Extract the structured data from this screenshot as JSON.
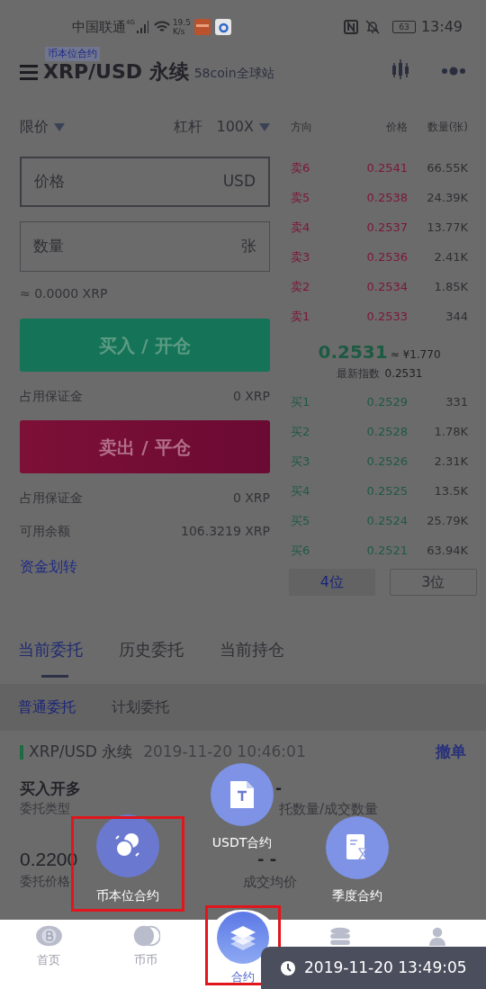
{
  "status_bar": {
    "carrier": "中国联通",
    "network": "4G",
    "speed": "19.5",
    "speed_unit": "K/s",
    "battery": "63",
    "time": "13:49"
  },
  "header": {
    "badge": "币本位合约",
    "title": "XRP/USD 永续",
    "subtitle": "58coin全球站"
  },
  "order_form": {
    "order_type": "限价",
    "leverage_label": "杠杆",
    "leverage": "100X",
    "price_field": {
      "placeholder": "价格",
      "unit": "USD"
    },
    "amount_field": {
      "placeholder": "数量",
      "unit": "张"
    },
    "estimate": "≈ 0.0000 XRP",
    "buy_button": "买入 / 开仓",
    "buy_margin": {
      "label": "占用保证金",
      "value": "0 XRP"
    },
    "sell_button": "卖出 / 平仓",
    "sell_margin": {
      "label": "占用保证金",
      "value": "0 XRP"
    },
    "available": {
      "label": "可用余额",
      "value": "106.3219 XRP"
    },
    "transfer_link": "资金划转"
  },
  "order_book": {
    "columns": [
      "方向",
      "价格",
      "数量(张)"
    ],
    "asks": [
      {
        "side": "卖6",
        "price": "0.2541",
        "amount": "66.55K"
      },
      {
        "side": "卖5",
        "price": "0.2538",
        "amount": "24.39K"
      },
      {
        "side": "卖4",
        "price": "0.2537",
        "amount": "13.77K"
      },
      {
        "side": "卖3",
        "price": "0.2536",
        "amount": "2.41K"
      },
      {
        "side": "卖2",
        "price": "0.2534",
        "amount": "1.85K"
      },
      {
        "side": "卖1",
        "price": "0.2533",
        "amount": "344"
      }
    ],
    "last_price": "0.2531",
    "cny": "≈ ¥1.770",
    "index_label": "最新指数",
    "index": "0.2531",
    "bids": [
      {
        "side": "买1",
        "price": "0.2529",
        "amount": "331"
      },
      {
        "side": "买2",
        "price": "0.2528",
        "amount": "1.78K"
      },
      {
        "side": "买3",
        "price": "0.2526",
        "amount": "2.31K"
      },
      {
        "side": "买4",
        "price": "0.2525",
        "amount": "13.5K"
      },
      {
        "side": "买5",
        "price": "0.2524",
        "amount": "25.79K"
      },
      {
        "side": "买6",
        "price": "0.2521",
        "amount": "63.94K"
      }
    ],
    "precision_buttons": [
      {
        "label": "4位",
        "selected": true
      },
      {
        "label": "3位",
        "selected": false
      }
    ]
  },
  "tabs": [
    {
      "label": "当前委托",
      "selected": true
    },
    {
      "label": "历史委托",
      "selected": false
    },
    {
      "label": "当前持仓",
      "selected": false
    }
  ],
  "sub_tabs": [
    {
      "label": "普通委托",
      "selected": true
    },
    {
      "label": "计划委托",
      "selected": false
    }
  ],
  "order": {
    "pair": "XRP/USD 永续",
    "time": "2019-11-20 10:46:01",
    "cancel": "撤单",
    "side": "买入开多",
    "side_label": "委托类型",
    "amount": "-",
    "amount_label": "托数量/成交数量",
    "price": "0.2200",
    "price_label": "委托价格",
    "avg": "- -",
    "avg_label": "成交均价"
  },
  "fab_menu": [
    {
      "kind": "coins",
      "label": "币本位合约",
      "highlighted": true
    },
    {
      "kind": "doc",
      "label": "USDT合约",
      "highlighted": false
    },
    {
      "kind": "hourglass",
      "label": "季度合约",
      "highlighted": false
    }
  ],
  "bottom_nav": [
    {
      "kind": "bitcoin",
      "label": "首页",
      "selected": false,
      "highlighted": false
    },
    {
      "kind": "moons",
      "label": "币币",
      "selected": false,
      "highlighted": false
    },
    {
      "kind": "layers",
      "label": "合约",
      "selected": true,
      "highlighted": true
    },
    {
      "kind": "stack",
      "selected": false,
      "highlighted": false
    },
    {
      "kind": "person",
      "selected": false,
      "highlighted": false
    }
  ],
  "toast": "2019-11-20 13:49:05"
}
